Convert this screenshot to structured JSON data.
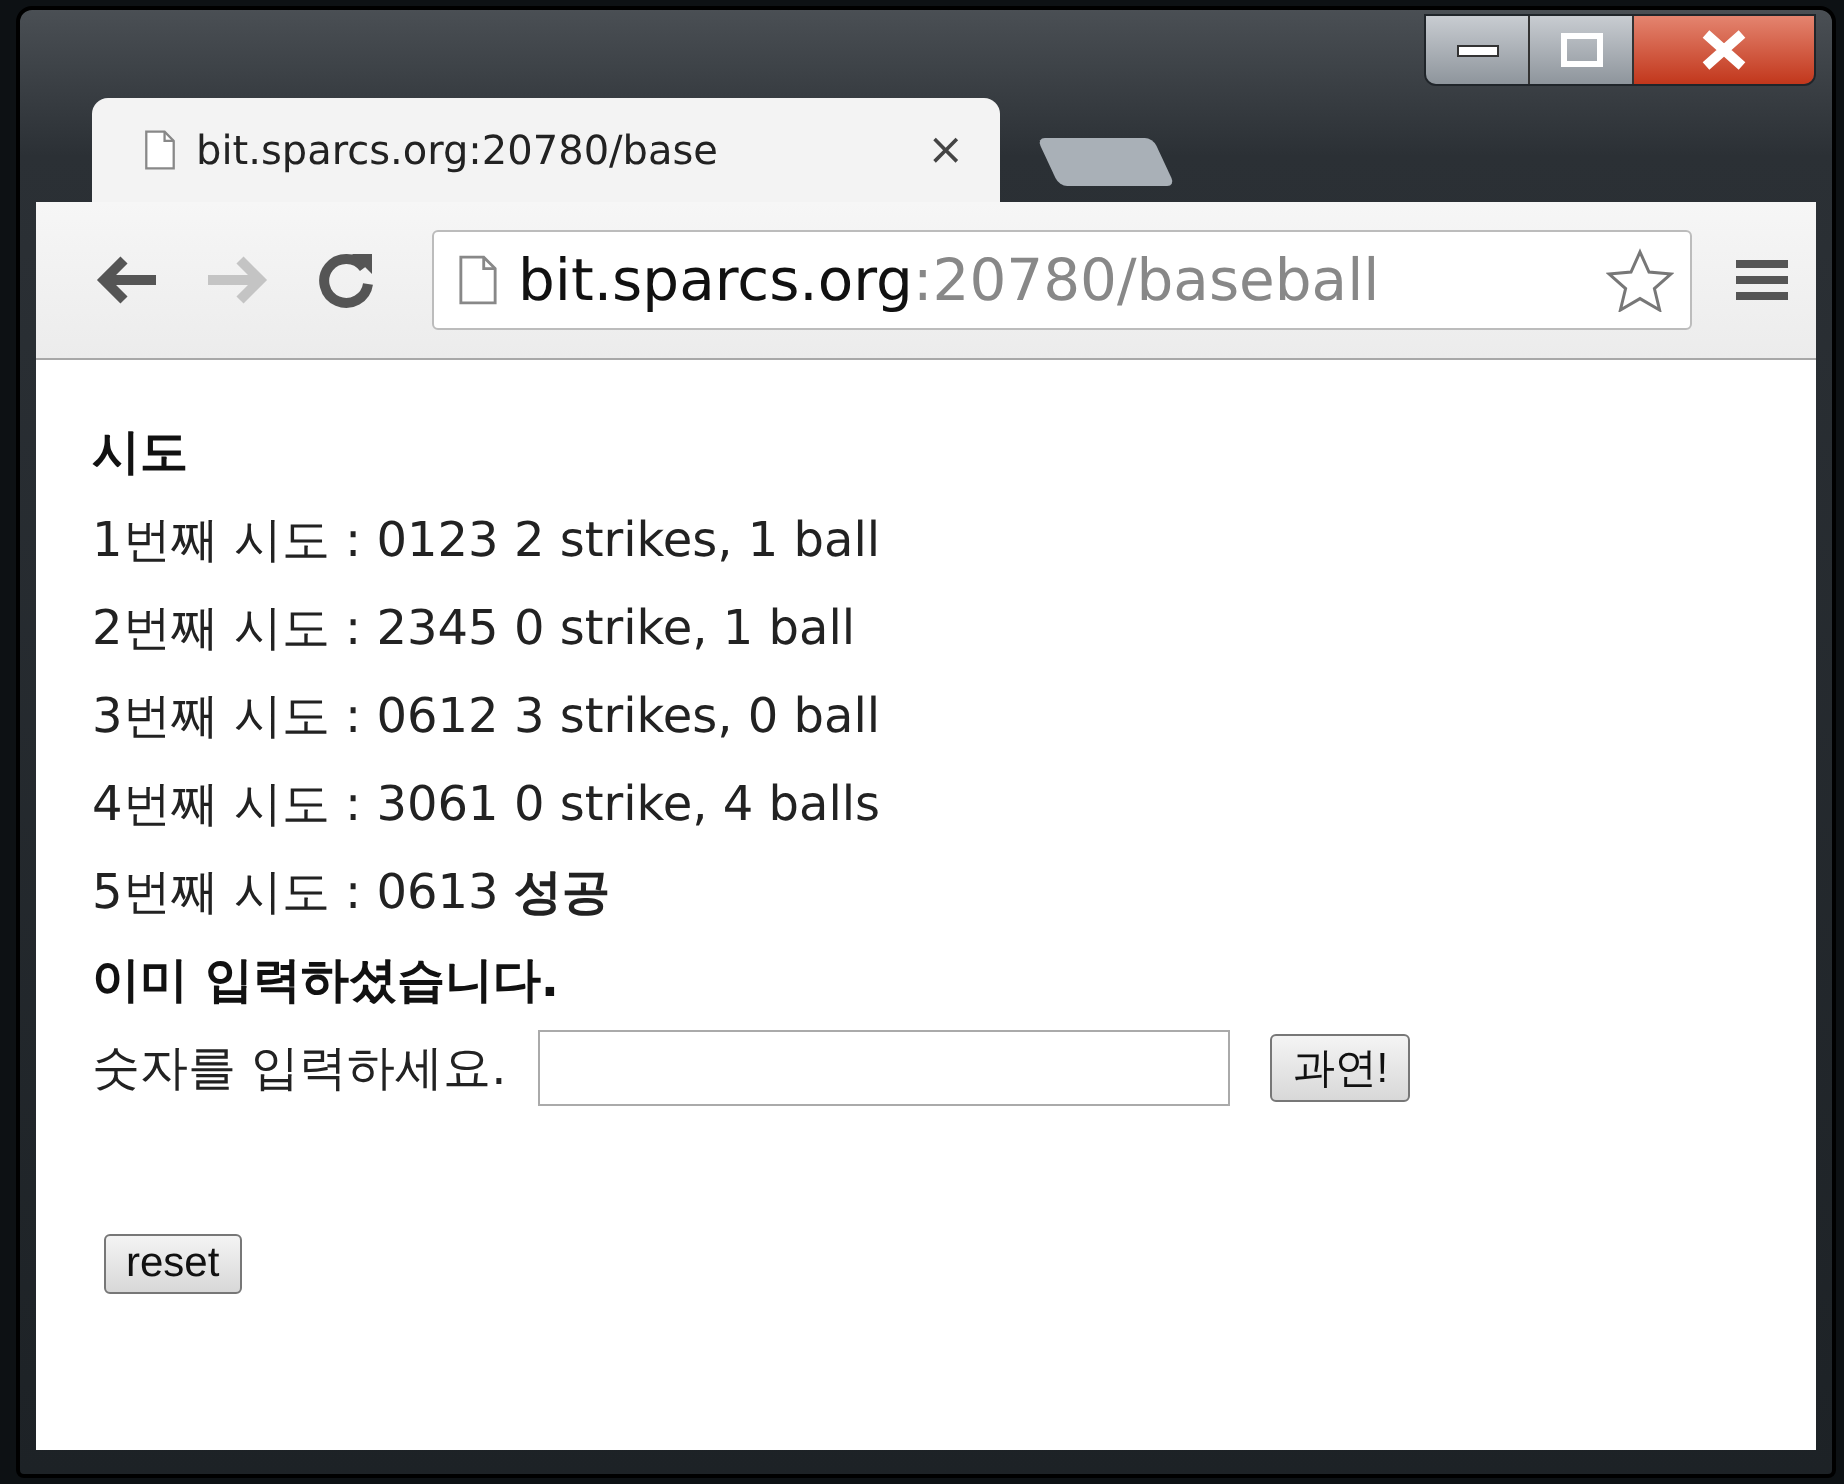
{
  "tab": {
    "title": "bit.sparcs.org:20780/base",
    "close": "×",
    "selected": true
  },
  "toolbar": {
    "back": {
      "disabled": false
    },
    "forward": {
      "disabled": true
    },
    "address": {
      "host": "bit.sparcs.org",
      "path": ":20780/baseball"
    }
  },
  "page": {
    "heading": "시도",
    "attempts": [
      "1번째 시도 : 0123 2 strikes, 1 ball",
      "2번째 시도 : 2345 0 strike, 1 ball",
      "3번째 시도 : 0612 3 strikes, 0 ball",
      "4번째 시도 : 3061 0 strike, 4 balls",
      "5번째 시도 : 0613 **성공**"
    ],
    "notice": "이미 입력하셨습니다.",
    "prompt": "숫자를 입력하세요.",
    "submit": "과연!",
    "reset": "reset"
  }
}
